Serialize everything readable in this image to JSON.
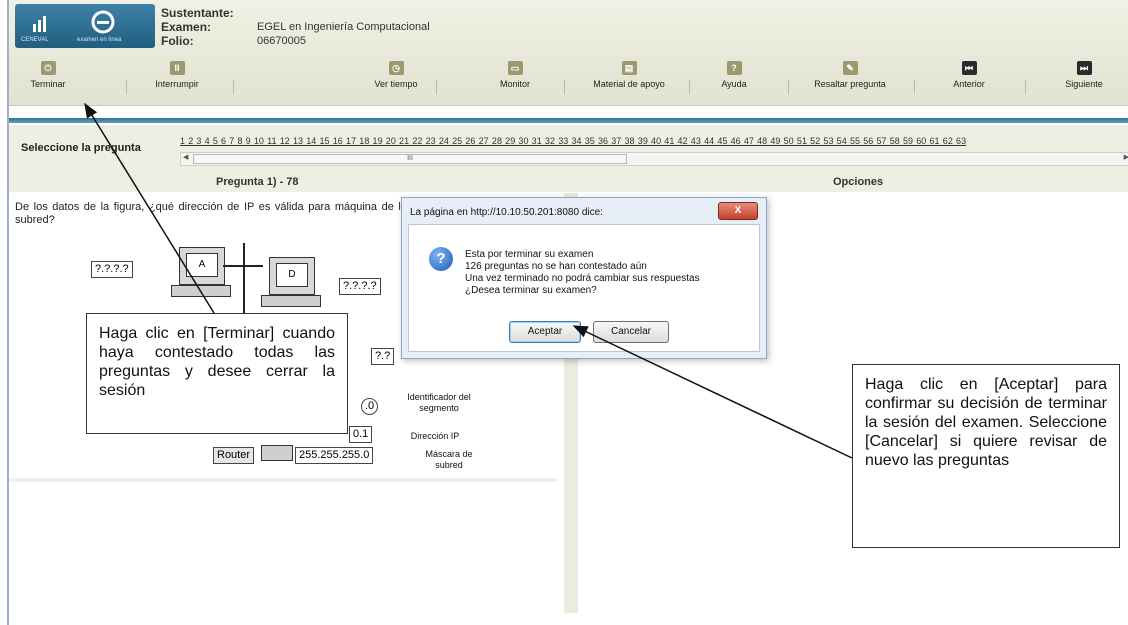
{
  "header": {
    "logo_text_left": "CENEVAL",
    "logo_text_right": "examen en línea",
    "info": [
      {
        "label": "Sustentante:",
        "value": ""
      },
      {
        "label": "Examen:",
        "value": "EGEL en Ingeniería Computacional"
      },
      {
        "label": "Folio:",
        "value": "06670005"
      }
    ]
  },
  "toolbar": {
    "terminar": "Terminar",
    "interrumpir": "Interrumpir",
    "ver_tiempo": "Ver tiempo",
    "monitor": "Monitor",
    "material": "Material de apoyo",
    "ayuda": "Ayuda",
    "resaltar": "Resaltar pregunta",
    "anterior": "Anterior",
    "siguiente": "Siguiente"
  },
  "selector": {
    "label": "Seleccione la pregunta",
    "numbers": "1 2 3 4 5 6 7 8 9 10 11 12 13 14 15 16 17 18 19 20 21 22 23 24 25 26 27 28 29 30 31 32 33 34 35 36 37 38 39 40 41 42 43 44 45 46 47 48 49 50 51 52 53 54 55 56 57 58 59 60 61 62 63",
    "scroll_thumb": "III"
  },
  "columns": {
    "question_header": "Pregunta 1) - 78",
    "options_header": "Opciones"
  },
  "question": {
    "text": "De los datos de la figura, ¿qué dirección de IP es válida para máquina de la subred?"
  },
  "diagram": {
    "ip_left": "?.?.?.?",
    "ip_right": "?.?.?.?",
    "ip_mid": "?.?",
    "pc_a": "A",
    "pc_d": "D",
    "seg_val": ".0",
    "seg_label": "Identificador del segmento",
    "ip_val": "0.1",
    "ip_label": "Dirección IP",
    "router": "Router",
    "mask_val": "255.255.255.0",
    "mask_label": "Máscara de subred"
  },
  "callouts": {
    "left": "Haga clic en [Terminar] cuando haya contestado todas las preguntas y desee cerrar la sesión",
    "right": "Haga clic en [Aceptar] para confirmar su decisión de terminar la sesión del examen. Seleccione [Cancelar] si quiere revisar de nuevo las preguntas"
  },
  "dialog": {
    "title": "La página en http://10.10.50.201:8080 dice:",
    "close": "X",
    "lines": [
      "Esta por terminar su examen",
      "126 preguntas no se han contestado aún",
      "Una vez terminado no podrá cambiar sus respuestas",
      "¿Desea terminar su examen?"
    ],
    "accept": "Aceptar",
    "cancel": "Cancelar"
  }
}
